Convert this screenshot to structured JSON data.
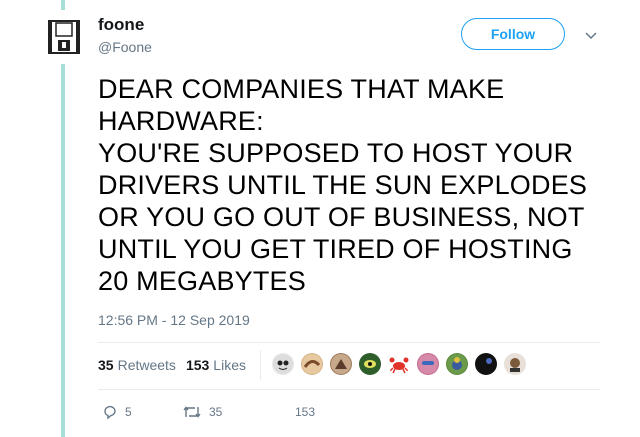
{
  "author": {
    "display_name": "foone",
    "handle": "@Foone",
    "avatar_icon": "floppy-disk-icon"
  },
  "follow_label": "Follow",
  "tweet_lines": [
    "DEAR COMPANIES THAT MAKE",
    "HARDWARE:",
    "YOU'RE SUPPOSED TO HOST YOUR",
    "DRIVERS UNTIL THE SUN EXPLODES",
    "OR YOU GO OUT OF BUSINESS, NOT",
    "UNTIL YOU GET TIRED OF HOSTING",
    "20 MEGABYTES"
  ],
  "timestamp": "12:56 PM - 12 Sep 2019",
  "stats": {
    "retweets_count": "35",
    "retweets_label": "Retweets",
    "likes_count": "153",
    "likes_label": "Likes"
  },
  "likers": [
    {
      "icon": "liker-avatar-1",
      "color": "#555555"
    },
    {
      "icon": "liker-avatar-2",
      "color": "#b98a5a"
    },
    {
      "icon": "liker-avatar-3",
      "color": "#8a6a4a"
    },
    {
      "icon": "liker-avatar-4",
      "color": "#2e5e2a"
    },
    {
      "icon": "crab-icon",
      "color": "#e0332a"
    },
    {
      "icon": "liker-avatar-6",
      "color": "#c06a8a"
    },
    {
      "icon": "liker-avatar-7",
      "color": "#5a8a3a"
    },
    {
      "icon": "liker-avatar-8",
      "color": "#111111"
    },
    {
      "icon": "liker-avatar-9",
      "color": "#7a5a3a"
    }
  ],
  "actions": {
    "reply_count": "5",
    "retweet_count": "35",
    "like_count": "153"
  },
  "colors": {
    "accent": "#1da1f2",
    "thread_line": "#a8ddd6",
    "muted": "#657786"
  }
}
